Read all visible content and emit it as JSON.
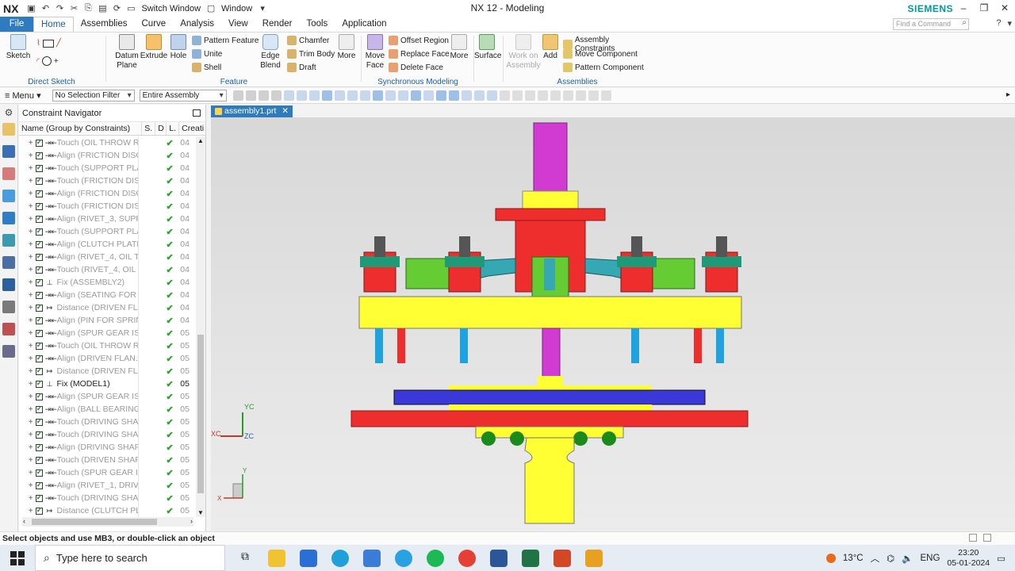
{
  "titlebar": {
    "app": "NX",
    "title": "NX 12 - Modeling",
    "brand": "SIEMENS",
    "switch_window": "Switch Window",
    "window_menu": "Window"
  },
  "tabs": [
    "Home",
    "Assemblies",
    "Curve",
    "Analysis",
    "View",
    "Render",
    "Tools",
    "Application"
  ],
  "file_tab": "File",
  "command_search_placeholder": "Find a Command",
  "ribbon": {
    "direct_sketch": {
      "label": "Direct Sketch",
      "sketch": "Sketch"
    },
    "feature": {
      "label": "Feature",
      "datum_plane": "Datum Plane",
      "extrude": "Extrude",
      "hole": "Hole",
      "pattern_feature": "Pattern Feature",
      "unite": "Unite",
      "shell": "Shell",
      "edge_blend": "Edge Blend",
      "chamfer": "Chamfer",
      "trim_body": "Trim Body",
      "draft": "Draft",
      "more": "More"
    },
    "synchronous": {
      "label": "Synchronous Modeling",
      "move_face": "Move Face",
      "offset_region": "Offset Region",
      "replace_face": "Replace Face",
      "delete_face": "Delete Face",
      "more": "More"
    },
    "surface": {
      "surface": "Surface"
    },
    "assemblies": {
      "label": "Assemblies",
      "work_on_assembly": "Work on Assembly",
      "add": "Add",
      "assembly_constraints": "Assembly Constraints",
      "move_component": "Move Component",
      "pattern_component": "Pattern Component"
    }
  },
  "toolbar": {
    "menu": "Menu",
    "selection_filter": "No Selection Filter",
    "scope": "Entire Assembly"
  },
  "navigator": {
    "title": "Constraint Navigator",
    "columns": [
      "Name (Group by Constraints)",
      "S.",
      "D",
      "L.",
      "Creati"
    ],
    "rows": [
      {
        "type": "touch",
        "name": "Touch (OIL THROW RI...",
        "cr": "04",
        "dim": true
      },
      {
        "type": "align",
        "name": "Align (FRICTION DISC...",
        "cr": "04",
        "dim": true
      },
      {
        "type": "touch",
        "name": "Touch (SUPPORT PLA...",
        "cr": "04",
        "dim": true
      },
      {
        "type": "touch",
        "name": "Touch (FRICTION DIS...",
        "cr": "04",
        "dim": true
      },
      {
        "type": "align",
        "name": "Align (FRICTION DISC...",
        "cr": "04",
        "dim": true
      },
      {
        "type": "touch",
        "name": "Touch (FRICTION DIS...",
        "cr": "04",
        "dim": true
      },
      {
        "type": "align",
        "name": "Align (RIVET_3, SUPP...",
        "cr": "04",
        "dim": true
      },
      {
        "type": "touch",
        "name": "Touch (SUPPORT PLA...",
        "cr": "04",
        "dim": true
      },
      {
        "type": "align",
        "name": "Align (CLUTCH PLATE...",
        "cr": "04",
        "dim": true
      },
      {
        "type": "align",
        "name": "Align (RIVET_4, OIL T...",
        "cr": "04",
        "dim": true
      },
      {
        "type": "touch",
        "name": "Touch (RIVET_4, OIL T...",
        "cr": "04",
        "dim": true
      },
      {
        "type": "fix",
        "name": "Fix (ASSEMBLY2)",
        "cr": "04",
        "dim": true
      },
      {
        "type": "align",
        "name": "Align (SEATING FOR ...",
        "cr": "04",
        "dim": true
      },
      {
        "type": "distance",
        "name": "Distance (DRIVEN FL...",
        "cr": "04",
        "dim": true
      },
      {
        "type": "align",
        "name": "Align (PIN FOR SPRIN...",
        "cr": "04",
        "dim": true
      },
      {
        "type": "align",
        "name": "Align (SPUR GEAR IS...",
        "cr": "05",
        "dim": true
      },
      {
        "type": "touch",
        "name": "Touch (OIL THROW RI...",
        "cr": "05",
        "dim": true
      },
      {
        "type": "align",
        "name": "Align (DRIVEN FLAN...",
        "cr": "05",
        "dim": true
      },
      {
        "type": "distance",
        "name": "Distance (DRIVEN FL...",
        "cr": "05",
        "dim": true
      },
      {
        "type": "fix",
        "name": "Fix (MODEL1)",
        "cr": "05",
        "dim": false
      },
      {
        "type": "align",
        "name": "Align (SPUR GEAR IS...",
        "cr": "05",
        "dim": true
      },
      {
        "type": "align",
        "name": "Align (BALL BEARING...",
        "cr": "05",
        "dim": true
      },
      {
        "type": "touch",
        "name": "Touch (DRIVING SHA...",
        "cr": "05",
        "dim": true
      },
      {
        "type": "touch",
        "name": "Touch (DRIVING SHA...",
        "cr": "05",
        "dim": true
      },
      {
        "type": "align",
        "name": "Align (DRIVING SHAF...",
        "cr": "05",
        "dim": true
      },
      {
        "type": "touch",
        "name": "Touch (DRIVEN SHAF...",
        "cr": "05",
        "dim": true
      },
      {
        "type": "touch",
        "name": "Touch (SPUR GEAR IS...",
        "cr": "05",
        "dim": true
      },
      {
        "type": "align",
        "name": "Align (RIVET_1, DRIVI...",
        "cr": "05",
        "dim": true
      },
      {
        "type": "touch",
        "name": "Touch (DRIVING SHA...",
        "cr": "05",
        "dim": true
      },
      {
        "type": "distance",
        "name": "Distance (CLUTCH PL...",
        "cr": "05",
        "dim": true
      }
    ]
  },
  "viewport": {
    "tab": "assembly1.prt",
    "triad_labels": {
      "yc": "YC",
      "xc": "XC",
      "zc": "ZC",
      "y": "Y",
      "x": "X"
    }
  },
  "status": "Select objects and use MB3, or double-click an object",
  "taskbar": {
    "search_placeholder": "Type here to search",
    "temperature": "13°C",
    "language": "ENG",
    "time": "23:20",
    "date": "05-01-2024"
  }
}
